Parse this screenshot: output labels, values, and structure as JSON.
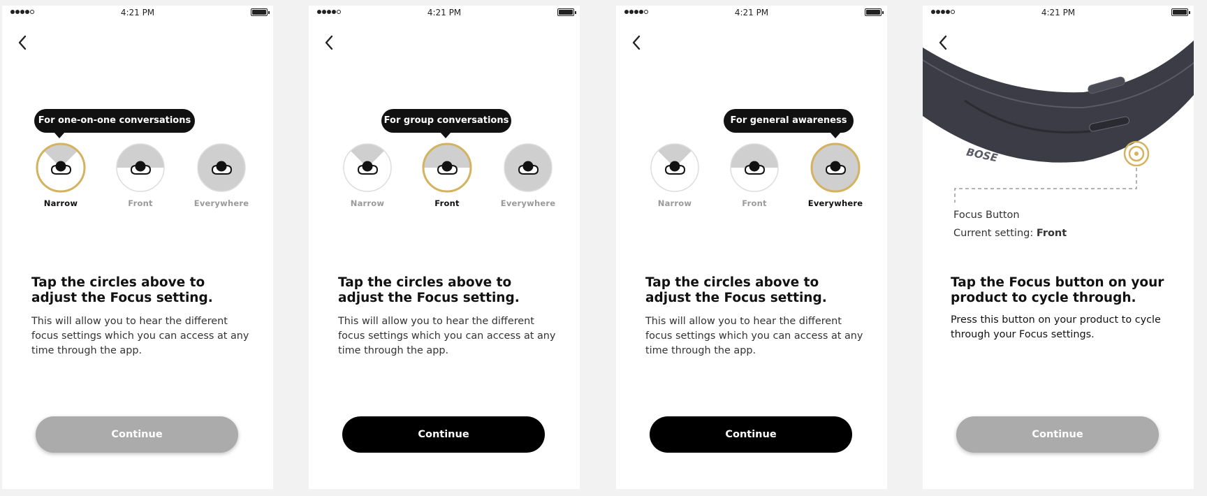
{
  "status": {
    "time": "4:21 PM"
  },
  "colors": {
    "accent_gold": "#d4b25e",
    "active_button": "#000000",
    "disabled_button": "#ababab",
    "tooltip_bg": "#111111",
    "sector_gray": "#cfcfcf"
  },
  "icons": {
    "back": "chevron-left-icon",
    "battery": "battery-icon",
    "signal": "signal-dots-icon",
    "head": "head-icon",
    "focus_ring": "focus-button-ring-icon"
  },
  "modes": [
    "Narrow",
    "Front",
    "Everywhere"
  ],
  "screens": [
    {
      "tooltip": "For one-on-one conversations",
      "selected": "Narrow",
      "title": "Tap the circles above to adjust the Focus setting.",
      "body": "This will allow you to hear the different focus settings which you can access at any time through the app.",
      "button": "Continue",
      "button_enabled": false
    },
    {
      "tooltip": "For group conversations",
      "selected": "Front",
      "title": "Tap the circles above to adjust the Focus setting.",
      "body": "This will allow you to hear the different focus settings which you can access at any time through the app.",
      "button": "Continue",
      "button_enabled": true
    },
    {
      "tooltip": "For general awareness",
      "selected": "Everywhere",
      "title": "Tap the circles above to adjust the Focus setting.",
      "body": "This will allow you to hear the different focus settings which you can access at any time through the app.",
      "button": "Continue",
      "button_enabled": true
    },
    {
      "brand": "BOSE",
      "callout_label": "Focus Button",
      "current_setting_label": "Current setting:",
      "current_setting_value": "Front",
      "title": "Tap the Focus button on your product to cycle through.",
      "body": "Press this button on your product to cycle through your Focus settings.",
      "button": "Continue",
      "button_enabled": false
    }
  ]
}
